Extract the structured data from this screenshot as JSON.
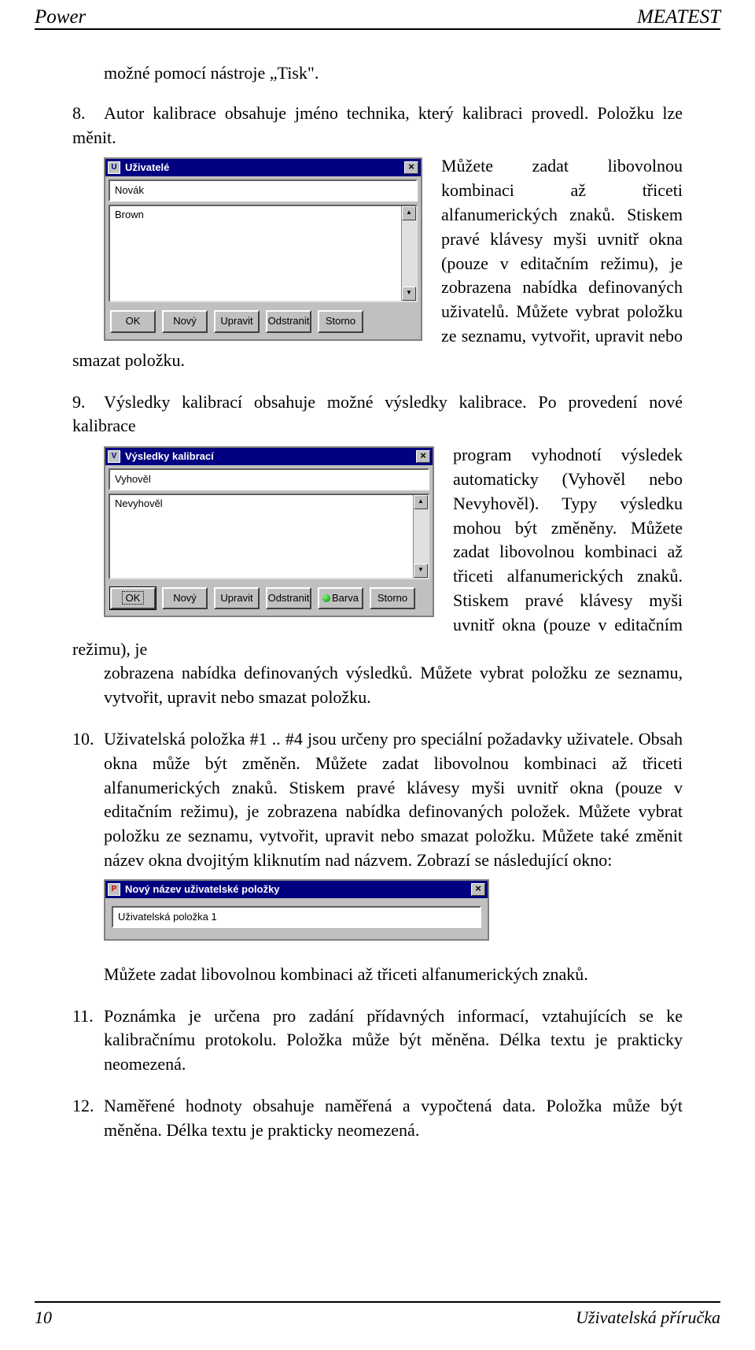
{
  "header": {
    "left": "Power",
    "right": "MEATEST"
  },
  "footer": {
    "left": "10",
    "right": "Uživatelská příručka"
  },
  "intro": "možné pomocí nástroje „Tisk\".",
  "item8": {
    "num": "8.",
    "first": "Autor kalibrace obsahuje jméno technika, který kalibraci provedl. Položku lze měnit.",
    "cont": "Můžete zadat libovolnou kombinaci až třiceti alfanumerických znaků. Stiskem pravé klávesy myši uvnitř okna (pouze v editačním režimu), je zobrazena nabídka definovaných uživatelů. Můžete vybrat položku ze seznamu, vytvořit, upravit nebo smazat položku."
  },
  "item9": {
    "num": "9.",
    "first": "Výsledky kalibrací obsahuje možné výsledky kalibrace. Po provedení nové kalibrace",
    "wrap": "program vyhodnotí výsledek automaticky (Vyhověl nebo Nevyhověl). Typy výsledku mohou být změněny. Můžete zadat libovolnou kombinaci až třiceti alfanumerických znaků. Stiskem pravé klávesy myši uvnitř okna (pouze v editačním režimu), je",
    "rest": "zobrazena nabídka definovaných výsledků. Můžete vybrat položku ze seznamu, vytvořit, upravit nebo smazat položku."
  },
  "item10": {
    "num": "10.",
    "text": "Uživatelská položka #1 .. #4 jsou určeny pro speciální požadavky uživatele. Obsah okna může být změněn. Můžete zadat libovolnou kombinaci až třiceti alfanumerických znaků. Stiskem pravé klávesy myši uvnitř okna (pouze v editačním režimu), je zobrazena nabídka definovaných položek. Můžete vybrat položku ze seznamu, vytvořit, upravit nebo smazat položku. Můžete také změnit název okna dvojitým kliknutím nad názvem. Zobrazí se následující okno:",
    "after": "Můžete zadat libovolnou kombinaci až třiceti alfanumerických znaků."
  },
  "item11": {
    "num": "11.",
    "text": "Poznámka je určena pro zadání přídavných informací, vztahujících se ke kalibračnímu protokolu. Položka může být měněna. Délka textu je prakticky neomezená."
  },
  "item12": {
    "num": "12.",
    "text": "Naměřené hodnoty obsahuje naměřená a vypočtená data. Položka může být měněna. Délka textu je prakticky neomezená."
  },
  "win_users": {
    "title": "Uživatelé",
    "field": "Novák",
    "list": [
      "Brown"
    ],
    "buttons": {
      "ok": "OK",
      "novy": "Nový",
      "upravit": "Upravit",
      "odstranit": "Odstranit",
      "storno": "Storno"
    }
  },
  "win_results": {
    "title": "Výsledky kalibrací",
    "field": "Vyhověl",
    "list": [
      "Nevyhověl"
    ],
    "buttons": {
      "ok": "OK",
      "novy": "Nový",
      "upravit": "Upravit",
      "odstranit": "Odstranit",
      "barva": "Barva",
      "storno": "Storno"
    }
  },
  "win_rename": {
    "title": "Nový název uživatelské položky",
    "field": "Uživatelská položka 1"
  },
  "icons": {
    "close": "×",
    "up": "▲",
    "down": "▼"
  }
}
